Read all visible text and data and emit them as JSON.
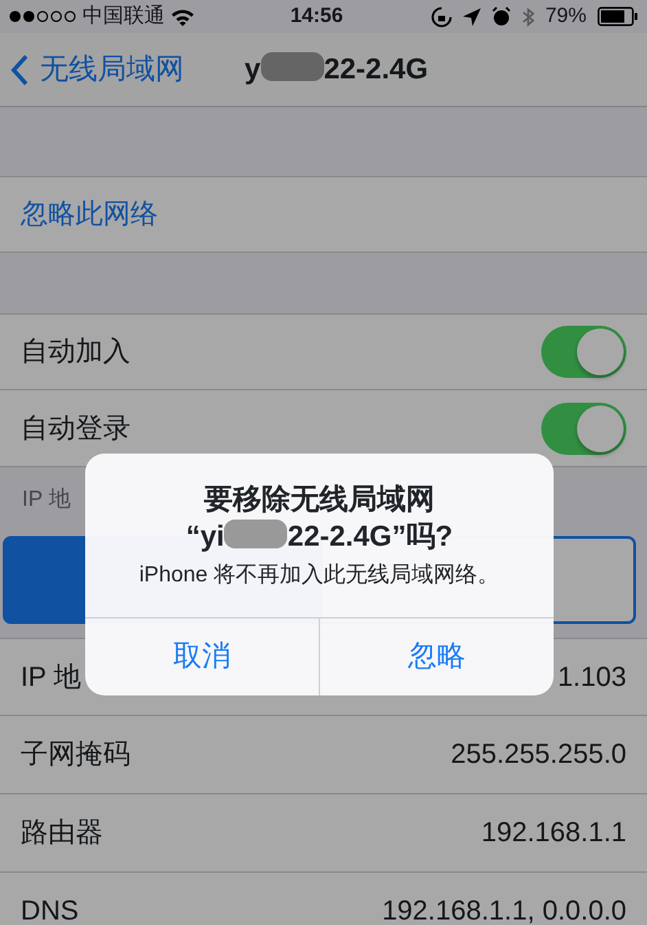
{
  "status_bar": {
    "carrier": "中国联通",
    "time": "14:56",
    "battery": "79%",
    "bluetooth_disabled": true
  },
  "nav": {
    "back": "无线局域网",
    "title": {
      "before": "y",
      "after": "22-2.4G"
    }
  },
  "forget": "忽略此网络",
  "toggles": [
    {
      "label": "自动加入",
      "on": true
    },
    {
      "label": "自动登录",
      "on": true
    }
  ],
  "ip_header": "IP 地",
  "segments": [
    {
      "selected": true
    },
    {
      "selected": false
    }
  ],
  "rows": [
    {
      "label": "IP 地",
      "value": "1.103"
    },
    {
      "label": "子网掩码",
      "value": "255.255.255.0"
    },
    {
      "label": "路由器",
      "value": "192.168.1.1"
    },
    {
      "label": "DNS",
      "value": "192.168.1.1, 0.0.0.0"
    }
  ],
  "alert": {
    "title_line": "要移除无线局域网",
    "name": {
      "before": "“yi",
      "after": "22-2.4G”吗?"
    },
    "message": "iPhone 将不再加入此无线局域网络。",
    "buttons": [
      "取消",
      "忽略"
    ]
  }
}
